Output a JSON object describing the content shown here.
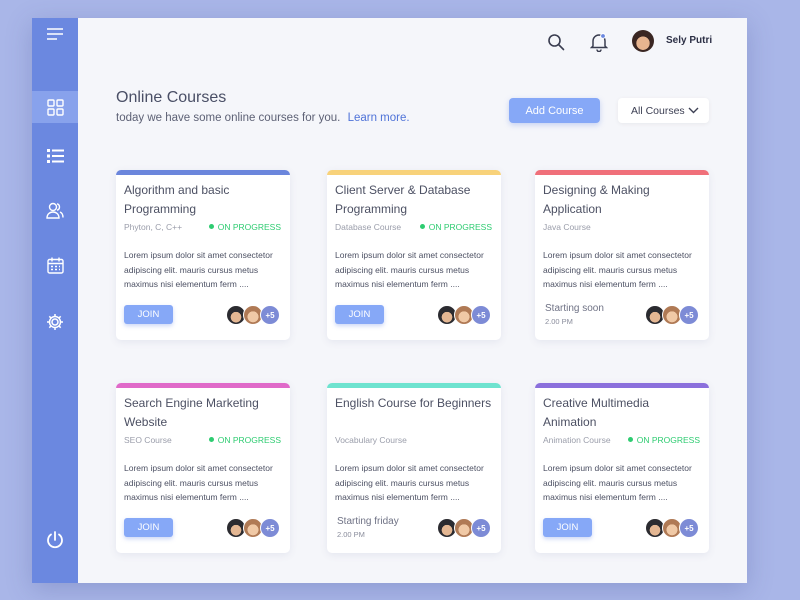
{
  "user": {
    "name": "Sely Putri"
  },
  "header": {
    "title": "Online Courses",
    "subtitle": "today we have some online courses for you.",
    "learn_more": "Learn more.",
    "add_course": "Add Course",
    "filter": "All Courses"
  },
  "sidebar": {
    "icons": [
      "menu-icon",
      "dashboard-grid-icon",
      "list-icon",
      "users-icon",
      "calendar-icon",
      "settings-gear-icon",
      "power-icon"
    ],
    "active": "dashboard-grid-icon"
  },
  "colors": {
    "sidebar": "#6b88e0",
    "accent": "#86a8f7",
    "status_green": "#2ecc71"
  },
  "courses": [
    {
      "title": "Algorithm and basic Programming",
      "category": "Phyton, C, C++",
      "status": "ON PROGRESS",
      "description": "Lorem ipsum dolor sit amet consectetor adipiscing elit. mauris cursus metus maximus nisi elementum ferm ....",
      "action": "JOIN",
      "extra": "+5",
      "color": "#6b86dc"
    },
    {
      "title": "Client Server & Database Programming",
      "category": "Database Course",
      "status": "ON PROGRESS",
      "description": "Lorem ipsum dolor sit amet consectetor adipiscing elit. mauris cursus metus maximus nisi elementum ferm ....",
      "action": "JOIN",
      "extra": "+5",
      "color": "#f8d27a"
    },
    {
      "title": "Designing & Making Application",
      "category": "Java Course",
      "description": "Lorem ipsum dolor sit amet consectetor adipiscing elit. mauris cursus metus maximus nisi elementum ferm ....",
      "soon_label": "Starting soon",
      "soon_time": "2.00 PM",
      "extra": "+5",
      "color": "#f0707a"
    },
    {
      "title": "Search Engine Marketing Website",
      "category": "SEO Course",
      "status": "ON PROGRESS",
      "description": "Lorem ipsum dolor sit amet consectetor adipiscing elit. mauris cursus metus maximus nisi elementum ferm ....",
      "action": "JOIN",
      "extra": "+5",
      "color": "#e06ac9"
    },
    {
      "title": "English Course for Beginners",
      "category": "Vocabulary Course",
      "description": "Lorem ipsum dolor sit amet consectetor adipiscing elit. mauris cursus metus maximus nisi elementum ferm ....",
      "soon_label": "Starting friday",
      "soon_time": "2.00 PM",
      "extra": "+5",
      "color": "#6ee3cf"
    },
    {
      "title": "Creative Multimedia Animation",
      "category": "Animation Course",
      "status": "ON PROGRESS",
      "description": "Lorem ipsum dolor sit amet consectetor adipiscing elit. mauris cursus metus maximus nisi elementum ferm ....",
      "action": "JOIN",
      "extra": "+5",
      "color": "#8b70dc"
    }
  ]
}
